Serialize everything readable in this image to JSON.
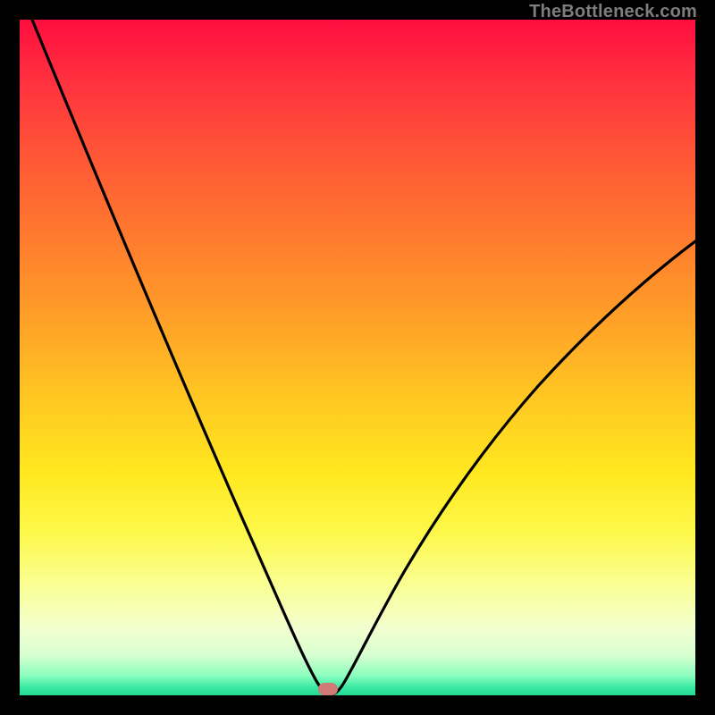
{
  "watermark": "TheBottleneck.com",
  "colors": {
    "frame": "#000000",
    "curve": "#000000",
    "marker": "#cf7a74",
    "watermark_text": "#7d7d7d"
  },
  "chart_data": {
    "type": "line",
    "title": "",
    "xlabel": "",
    "ylabel": "",
    "xlim": [
      0,
      100
    ],
    "ylim": [
      0,
      100
    ],
    "grid": false,
    "legend": false,
    "annotations": [
      "TheBottleneck.com"
    ],
    "series": [
      {
        "name": "bottleneck-curve",
        "x": [
          0,
          5,
          10,
          15,
          20,
          25,
          30,
          35,
          40,
          43,
          45,
          47,
          50,
          55,
          60,
          65,
          70,
          75,
          80,
          85,
          90,
          95,
          100
        ],
        "values": [
          100,
          89,
          78,
          67,
          56,
          45,
          34,
          23,
          11,
          3,
          0,
          2,
          6,
          13,
          20,
          27,
          33,
          39,
          45,
          50,
          55,
          60,
          65
        ]
      }
    ],
    "marker": {
      "x": 45,
      "y": 0
    },
    "background_gradient": {
      "top": "#ff0e3f",
      "middle": "#ffe81f",
      "bottom": "#25d992"
    }
  }
}
